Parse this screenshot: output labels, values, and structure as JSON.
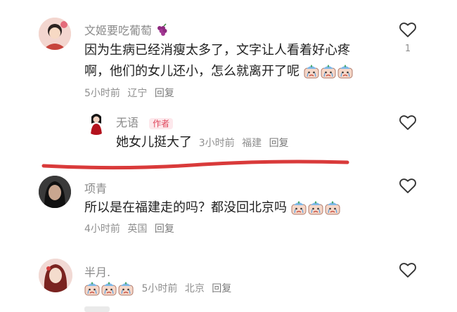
{
  "comments": [
    {
      "author": "文姬要吃葡萄",
      "author_emoji": "grape-emoji",
      "text_line1": "因为生病已经消瘦太多了，文字让人看着好心疼",
      "text_line2": "啊，他们的女儿还小，怎么就离开了呢",
      "emoji_count": 3,
      "time": "5小时前",
      "location": "辽宁",
      "reply_label": "回复",
      "like_count": "1"
    },
    {
      "author": "无语",
      "author_tag": "作者",
      "text": "她女儿挺大了",
      "time": "3小时前",
      "location": "福建",
      "reply_label": "回复"
    },
    {
      "author": "项青",
      "text": "所以是在福建走的吗？都没回北京吗",
      "emoji_count": 3,
      "time": "4小时前",
      "location": "英国",
      "reply_label": "回复"
    },
    {
      "author": "半月.",
      "emoji_count": 3,
      "time": "5小时前",
      "location": "北京",
      "reply_label": "回复"
    }
  ],
  "colors": {
    "underline": "#d93a3a",
    "author_tag": "#e04a5f"
  },
  "icons": {
    "like": "heart-outline-icon",
    "inline_emoji": "crying-face-emoji"
  }
}
